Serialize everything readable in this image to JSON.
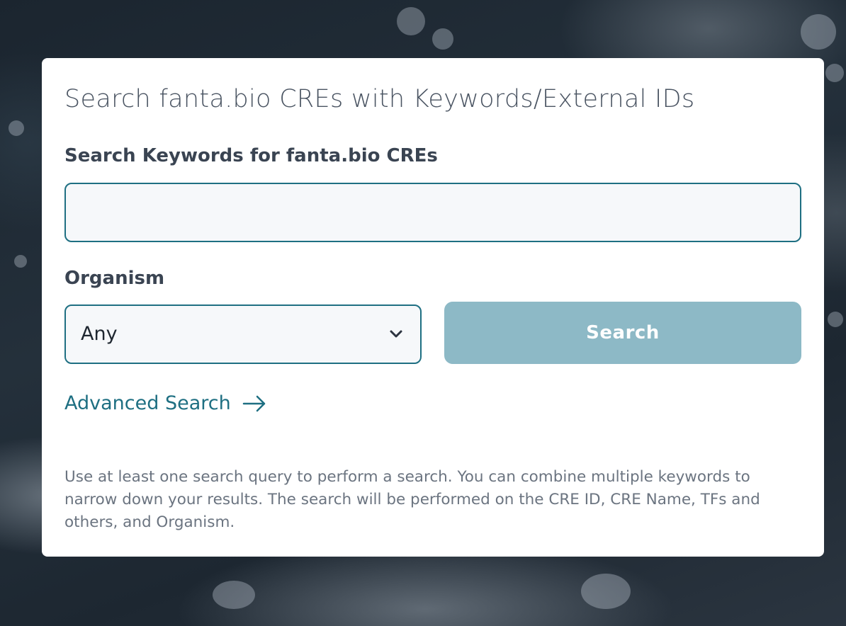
{
  "card": {
    "title": "Search fanta.bio CREs with Keywords/External IDs"
  },
  "keywords": {
    "label": "Search Keywords for fanta.bio CREs",
    "value": "",
    "placeholder": ""
  },
  "organism": {
    "label": "Organism",
    "selected": "Any",
    "icon": "chevron-down-icon"
  },
  "search_button": {
    "label": "Search",
    "color": "#8db9c6"
  },
  "advanced_link": {
    "label": "Advanced Search",
    "icon": "arrow-right-icon",
    "color": "#1e6f82"
  },
  "help": {
    "text": "Use at least one search query to perform a search. You can combine multiple keywords to narrow down your results. The search will be performed on the CRE ID, CRE Name, TFs and others, and Organism."
  },
  "colors": {
    "accent": "#1e6f82",
    "card_background": "#ffffff",
    "input_background": "#f6f8fa"
  }
}
